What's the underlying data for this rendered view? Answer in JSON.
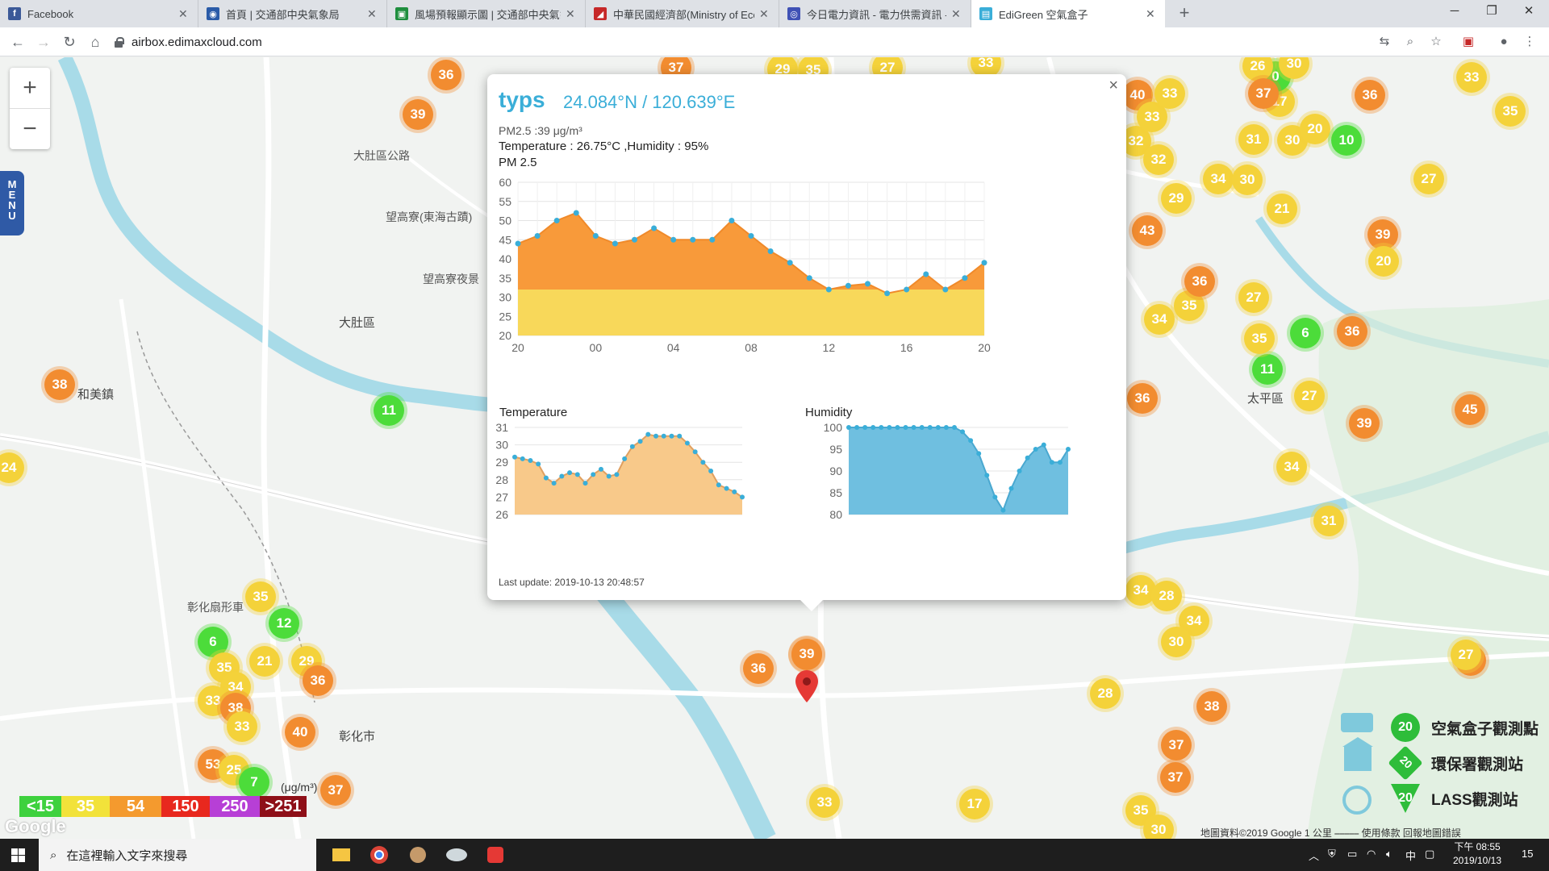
{
  "browser": {
    "tabs": [
      {
        "title": "Facebook",
        "favicon": "facebook-icon",
        "color": "#3b5998",
        "glyph": "f"
      },
      {
        "title": "首頁 | 交通部中央氣象局",
        "favicon": "cwb-icon",
        "color": "#2a5ba8",
        "glyph": "◉"
      },
      {
        "title": "風場預報顯示圖 | 交通部中央氣象",
        "favicon": "map-icon",
        "color": "#1e8e3e",
        "glyph": "▣"
      },
      {
        "title": "中華民國經濟部(Ministry of Econ",
        "favicon": "moea-icon",
        "color": "#c62828",
        "glyph": "◢"
      },
      {
        "title": "今日電力資訊 - 電力供需資訊 - 台",
        "favicon": "power-icon",
        "color": "#3f51b5",
        "glyph": "◎"
      },
      {
        "title": "EdiGreen 空氣盒子",
        "favicon": "edigreen-icon",
        "color": "#3aaed8",
        "glyph": "▤"
      }
    ],
    "url": "airbox.edimaxcloud.com"
  },
  "map": {
    "zoom_in": "+",
    "zoom_out": "−",
    "menu_label": "MENU",
    "places": [
      {
        "text": "大肚區公路"
      },
      {
        "text": "望高寮(東海古蹟)"
      },
      {
        "text": "望高寮夜景"
      },
      {
        "text": "大肚區"
      },
      {
        "text": "和美鎮"
      },
      {
        "text": "彰化市"
      },
      {
        "text": "太平區"
      },
      {
        "text": "彰化扇形車"
      }
    ],
    "markers": [
      {
        "value": "36",
        "level": "orange"
      },
      {
        "value": "39",
        "level": "orange"
      },
      {
        "value": "37",
        "level": "orange"
      },
      {
        "value": "29",
        "level": "yellow"
      },
      {
        "value": "35",
        "level": "yellow"
      },
      {
        "value": "27",
        "level": "yellow"
      },
      {
        "value": "33",
        "level": "yellow"
      },
      {
        "value": "38",
        "level": "orange"
      },
      {
        "value": "11",
        "level": "green"
      },
      {
        "value": "24",
        "level": "yellow"
      },
      {
        "value": "35",
        "level": "yellow"
      },
      {
        "value": "12",
        "level": "green"
      },
      {
        "value": "6",
        "level": "green"
      },
      {
        "value": "35",
        "level": "yellow"
      },
      {
        "value": "21",
        "level": "yellow"
      },
      {
        "value": "29",
        "level": "yellow"
      },
      {
        "value": "34",
        "level": "yellow"
      },
      {
        "value": "36",
        "level": "orange"
      },
      {
        "value": "33",
        "level": "yellow"
      },
      {
        "value": "38",
        "level": "orange"
      },
      {
        "value": "33",
        "level": "yellow"
      },
      {
        "value": "40",
        "level": "orange"
      },
      {
        "value": "53",
        "level": "orange"
      },
      {
        "value": "25",
        "level": "yellow"
      },
      {
        "value": "7",
        "level": "green"
      },
      {
        "value": "37",
        "level": "orange"
      },
      {
        "value": "36",
        "level": "orange"
      },
      {
        "value": "39",
        "level": "orange"
      },
      {
        "value": "33",
        "level": "yellow"
      },
      {
        "value": "17",
        "level": "yellow"
      },
      {
        "value": "28",
        "level": "yellow"
      },
      {
        "value": "37",
        "level": "orange"
      },
      {
        "value": "38",
        "level": "orange"
      },
      {
        "value": "37",
        "level": "orange"
      },
      {
        "value": "35",
        "level": "yellow"
      },
      {
        "value": "30",
        "level": "yellow"
      },
      {
        "value": "34",
        "level": "yellow"
      },
      {
        "value": "28",
        "level": "yellow"
      },
      {
        "value": "34",
        "level": "yellow"
      },
      {
        "value": "30",
        "level": "yellow"
      },
      {
        "value": "37",
        "level": "orange"
      },
      {
        "value": "31",
        "level": "yellow"
      },
      {
        "value": "34",
        "level": "yellow"
      },
      {
        "value": "45",
        "level": "orange"
      },
      {
        "value": "39",
        "level": "orange"
      },
      {
        "value": "27",
        "level": "yellow"
      },
      {
        "value": "36",
        "level": "orange"
      },
      {
        "value": "11",
        "level": "green"
      },
      {
        "value": "35",
        "level": "yellow"
      },
      {
        "value": "6",
        "level": "green"
      },
      {
        "value": "36",
        "level": "orange"
      },
      {
        "value": "34",
        "level": "yellow"
      },
      {
        "value": "35",
        "level": "yellow"
      },
      {
        "value": "27",
        "level": "yellow"
      },
      {
        "value": "36",
        "level": "orange"
      },
      {
        "value": "43",
        "level": "orange"
      },
      {
        "value": "29",
        "level": "yellow"
      },
      {
        "value": "21",
        "level": "yellow"
      },
      {
        "value": "39",
        "level": "orange"
      },
      {
        "value": "20",
        "level": "yellow"
      },
      {
        "value": "27",
        "level": "yellow"
      },
      {
        "value": "34",
        "level": "yellow"
      },
      {
        "value": "30",
        "level": "yellow"
      },
      {
        "value": "31",
        "level": "yellow"
      },
      {
        "value": "30",
        "level": "yellow"
      },
      {
        "value": "20",
        "level": "yellow"
      },
      {
        "value": "10",
        "level": "green"
      },
      {
        "value": "32",
        "level": "yellow"
      },
      {
        "value": "32",
        "level": "yellow"
      },
      {
        "value": "40",
        "level": "orange"
      },
      {
        "value": "33",
        "level": "yellow"
      },
      {
        "value": "33",
        "level": "yellow"
      },
      {
        "value": "36",
        "level": "orange"
      },
      {
        "value": "17",
        "level": "yellow"
      },
      {
        "value": "0",
        "level": "green"
      },
      {
        "value": "30",
        "level": "yellow"
      },
      {
        "value": "26",
        "level": "yellow"
      },
      {
        "value": "35",
        "level": "yellow"
      },
      {
        "value": "33",
        "level": "yellow"
      },
      {
        "value": "27",
        "level": "yellow"
      },
      {
        "value": "37",
        "level": "orange"
      },
      {
        "value": "29",
        "level": "yellow"
      }
    ],
    "selected_marker": "39",
    "colors": {
      "green": "#4cdc3a",
      "yellow": "#f4d23a",
      "orange": "#f28c30"
    }
  },
  "popup": {
    "title": "typs",
    "coords": "24.084°N / 120.639°E",
    "pm_line": "PM2.5 :39 μg/m³",
    "temp_humidity_line": "Temperature : 26.75°C ,Humidity : 95%",
    "pm_chart_label": "PM 2.5",
    "temperature_label": "Temperature",
    "humidity_label": "Humidity",
    "last_update": "Last update: 2019-10-13 20:48:57",
    "close": "×"
  },
  "chart_data": [
    {
      "type": "area",
      "title": "PM 2.5",
      "x_ticks": [
        "20",
        "00",
        "04",
        "08",
        "12",
        "16",
        "20"
      ],
      "ylim": [
        20,
        60
      ],
      "y_ticks": [
        20,
        25,
        30,
        35,
        40,
        45,
        50,
        55,
        60
      ],
      "values": [
        44,
        46,
        50,
        52,
        46,
        44,
        45,
        48,
        45,
        45,
        45,
        50,
        46,
        42,
        39,
        35,
        32,
        33,
        33.5,
        31,
        32,
        36,
        32,
        35,
        39
      ],
      "threshold": 32,
      "colors": {
        "above": "#f89a3a",
        "below": "#f8d85a",
        "point": "#3aaed8"
      }
    },
    {
      "type": "area",
      "title": "Temperature",
      "ylim": [
        26,
        31
      ],
      "y_ticks": [
        26,
        27,
        28,
        29,
        30,
        31
      ],
      "values": [
        29.3,
        29.2,
        29.1,
        28.9,
        28.1,
        27.8,
        28.2,
        28.4,
        28.3,
        27.8,
        28.3,
        28.6,
        28.2,
        28.3,
        29.2,
        29.9,
        30.2,
        30.6,
        30.5,
        30.5,
        30.5,
        30.5,
        30.1,
        29.6,
        29.0,
        28.5,
        27.7,
        27.5,
        27.3,
        27.0
      ],
      "colors": {
        "fill": "#f8c98a",
        "point": "#3aaed8"
      }
    },
    {
      "type": "area",
      "title": "Humidity",
      "ylim": [
        80,
        100
      ],
      "y_ticks": [
        80,
        85,
        90,
        95,
        100
      ],
      "values": [
        100,
        100,
        100,
        100,
        100,
        100,
        100,
        100,
        100,
        100,
        100,
        100,
        100,
        100,
        99,
        97,
        94,
        89,
        84,
        81,
        86,
        90,
        93,
        95,
        96,
        92,
        92,
        95
      ],
      "colors": {
        "fill": "#6fbfe0",
        "point": "#3aaed8"
      }
    }
  ],
  "legend": {
    "scale": [
      {
        "label": "<15",
        "color": "#3ed13e"
      },
      {
        "label": "35",
        "color": "#f2e23a"
      },
      {
        "label": "54",
        "color": "#f49a2e"
      },
      {
        "label": "150",
        "color": "#e8281e"
      },
      {
        "label": "250",
        "color": "#b73fd6"
      },
      {
        "label": ">251",
        "color": "#8e0f18"
      }
    ],
    "unit": "(μg/m³)",
    "google": "Google",
    "stations": [
      {
        "label": "空氣盒子觀測點",
        "value": "20",
        "icon": "airbox-station-icon"
      },
      {
        "label": "環保署觀測站",
        "value": "20",
        "icon": "epa-station-icon"
      },
      {
        "label": "LASS觀測站",
        "value": "20",
        "icon": "lass-station-icon"
      }
    ],
    "attribution": "地圖資料©2019 Google   1 公里 ⎯⎯⎯⎯⎯   使用條款   回報地圖錯誤"
  },
  "taskbar": {
    "search_placeholder": "在這裡輸入文字來搜尋",
    "time": "下午 08:55",
    "date": "2019/10/13",
    "ime": "中",
    "notif_count": "15"
  }
}
